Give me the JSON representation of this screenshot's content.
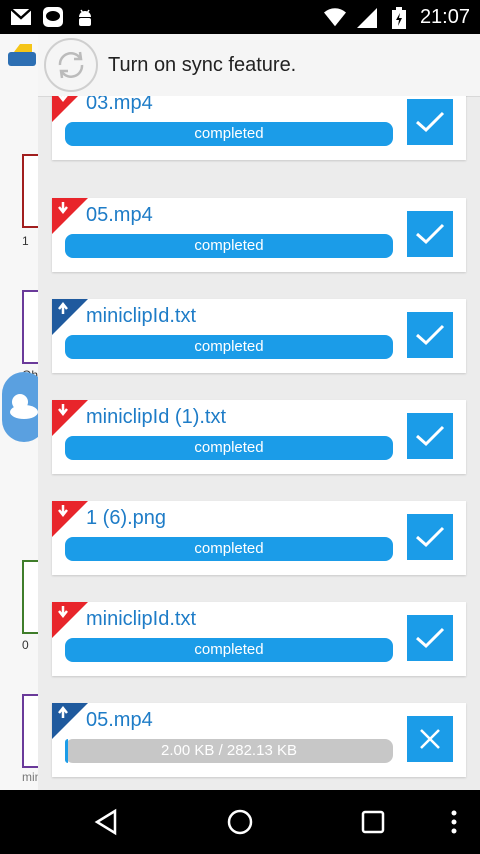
{
  "status_bar": {
    "time": "21:07",
    "icons": [
      "gmail-icon",
      "line-icon",
      "android-debug-icon",
      "wifi-icon",
      "signal-icon",
      "battery-icon"
    ]
  },
  "background_app": {
    "labels": [
      "1",
      "Oh",
      "0",
      "min"
    ]
  },
  "sync_bar": {
    "label": "Turn on sync feature."
  },
  "transfers": [
    {
      "file": "03.mp4",
      "direction": "download",
      "status": "completed",
      "action": "check"
    },
    {
      "file": "05.mp4",
      "direction": "download",
      "status": "completed",
      "action": "check"
    },
    {
      "file": "miniclipId.txt",
      "direction": "upload",
      "status": "completed",
      "action": "check"
    },
    {
      "file": "miniclipId (1).txt",
      "direction": "download",
      "status": "completed",
      "action": "check"
    },
    {
      "file": "1 (6).png",
      "direction": "download",
      "status": "completed",
      "action": "check"
    },
    {
      "file": "miniclipId.txt",
      "direction": "download",
      "status": "completed",
      "action": "check"
    },
    {
      "file": "05.mp4",
      "direction": "upload",
      "status": "2.00 KB / 282.13 KB",
      "progress": 0.007,
      "action": "cancel"
    }
  ],
  "colors": {
    "accent": "#1b9ce8",
    "download": "#e8252b",
    "upload": "#1f5a9e",
    "filename": "#1e7cc7"
  },
  "nav_bar": {
    "icons": [
      "back-icon",
      "home-icon",
      "recents-icon",
      "more-icon"
    ]
  }
}
